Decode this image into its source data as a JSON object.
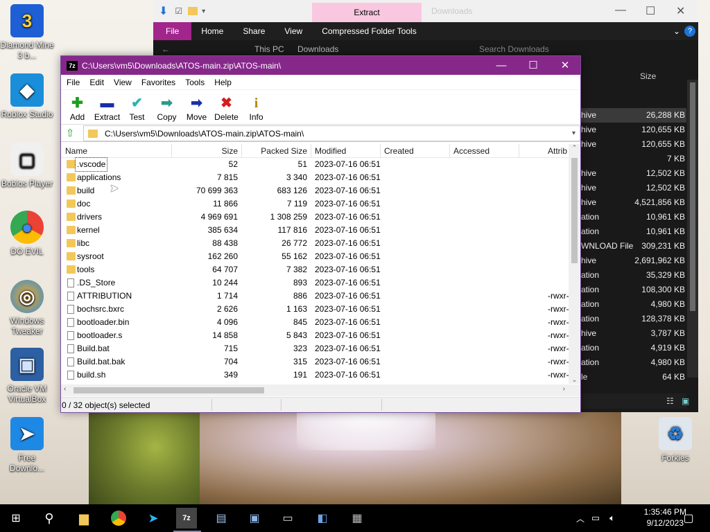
{
  "desktop": {
    "icons": [
      {
        "label": "Diamond Mine 3 b...",
        "glyph": "3"
      },
      {
        "label": "Roblox Studio",
        "glyph": "◆"
      },
      {
        "label": "Boblos Player",
        "glyph": "▢"
      },
      {
        "label": "DO EVIL",
        "glyph": "●"
      },
      {
        "label": "Windows Tweaker",
        "glyph": "◎"
      },
      {
        "label": "Oracle VM VirtualBox",
        "glyph": "▣"
      },
      {
        "label": "Free Downlo...",
        "glyph": "➤"
      },
      {
        "label": "Forkies",
        "glyph": "♻"
      }
    ]
  },
  "explorer": {
    "context_tab": "Extract",
    "faded_title": "Downloads",
    "ribbon": [
      "File",
      "Home",
      "Share",
      "View",
      "Compressed Folder Tools"
    ],
    "breadcrumb": [
      "This PC",
      "Downloads"
    ],
    "search_placeholder": "Search Downloads",
    "size_header": "Size",
    "rows": [
      {
        "type": "hive",
        "size": "26,288 KB",
        "selected": true
      },
      {
        "type": "hive",
        "size": "120,655 KB"
      },
      {
        "type": "hive",
        "size": "120,655 KB"
      },
      {
        "type": "",
        "size": "7 KB"
      },
      {
        "type": "hive",
        "size": "12,502 KB"
      },
      {
        "type": "hive",
        "size": "12,502 KB"
      },
      {
        "type": "hive",
        "size": "4,521,856 KB"
      },
      {
        "type": "ation",
        "size": "10,961 KB"
      },
      {
        "type": "ation",
        "size": "10,961 KB"
      },
      {
        "type": "WNLOAD File",
        "size": "309,231 KB"
      },
      {
        "type": "hive",
        "size": "2,691,962 KB"
      },
      {
        "type": "ation",
        "size": "35,329 KB"
      },
      {
        "type": "ation",
        "size": "108,300 KB"
      },
      {
        "type": "ation",
        "size": "4,980 KB"
      },
      {
        "type": "ation",
        "size": "128,378 KB"
      },
      {
        "type": "hive",
        "size": "3,787 KB"
      },
      {
        "type": "ation",
        "size": "4,919 KB"
      },
      {
        "type": "ation",
        "size": "4,980 KB"
      },
      {
        "type": "le",
        "size": "64 KB"
      }
    ]
  },
  "sevenzip": {
    "title": "C:\\Users\\vm5\\Downloads\\ATOS-main.zip\\ATOS-main\\",
    "app_icon": "7z",
    "menu": [
      "File",
      "Edit",
      "View",
      "Favorites",
      "Tools",
      "Help"
    ],
    "toolbar": [
      {
        "label": "Add",
        "glyph": "✚",
        "color": "#1e9e1e"
      },
      {
        "label": "Extract",
        "glyph": "▬",
        "color": "#1a2fa8"
      },
      {
        "label": "Test",
        "glyph": "✔",
        "color": "#2bb3b3"
      },
      {
        "label": "Copy",
        "glyph": "➡",
        "color": "#2a9a8a"
      },
      {
        "label": "Move",
        "glyph": "➡",
        "color": "#1a2fa8"
      },
      {
        "label": "Delete",
        "glyph": "✖",
        "color": "#d21f1f"
      },
      {
        "label": "Info",
        "glyph": "i",
        "color": "#b38a00"
      }
    ],
    "address": "C:\\Users\\vm5\\Downloads\\ATOS-main.zip\\ATOS-main\\",
    "columns": [
      "Name",
      "Size",
      "Packed Size",
      "Modified",
      "Created",
      "Accessed",
      "Attrib"
    ],
    "rows": [
      {
        "name": ".vscode",
        "kind": "folder",
        "size": "52",
        "packed": "51",
        "modified": "2023-07-16 06:51",
        "attrib": ""
      },
      {
        "name": "applications",
        "kind": "folder",
        "size": "7 815",
        "packed": "3 340",
        "modified": "2023-07-16 06:51",
        "attrib": ""
      },
      {
        "name": "build",
        "kind": "folder",
        "size": "70 699 363",
        "packed": "683 126",
        "modified": "2023-07-16 06:51",
        "attrib": ""
      },
      {
        "name": "doc",
        "kind": "folder",
        "size": "11 866",
        "packed": "7 119",
        "modified": "2023-07-16 06:51",
        "attrib": ""
      },
      {
        "name": "drivers",
        "kind": "folder",
        "size": "4 969 691",
        "packed": "1 308 259",
        "modified": "2023-07-16 06:51",
        "attrib": ""
      },
      {
        "name": "kernel",
        "kind": "folder",
        "size": "385 634",
        "packed": "117 816",
        "modified": "2023-07-16 06:51",
        "attrib": ""
      },
      {
        "name": "libc",
        "kind": "folder",
        "size": "88 438",
        "packed": "26 772",
        "modified": "2023-07-16 06:51",
        "attrib": ""
      },
      {
        "name": "sysroot",
        "kind": "folder",
        "size": "162 260",
        "packed": "55 162",
        "modified": "2023-07-16 06:51",
        "attrib": ""
      },
      {
        "name": "tools",
        "kind": "folder",
        "size": "64 707",
        "packed": "7 382",
        "modified": "2023-07-16 06:51",
        "attrib": ""
      },
      {
        "name": ".DS_Store",
        "kind": "file",
        "size": "10 244",
        "packed": "893",
        "modified": "2023-07-16 06:51",
        "attrib": ""
      },
      {
        "name": "ATTRIBUTION",
        "kind": "file",
        "size": "1 714",
        "packed": "886",
        "modified": "2023-07-16 06:51",
        "attrib": "-rwxr-"
      },
      {
        "name": "bochsrc.bxrc",
        "kind": "file",
        "size": "2 626",
        "packed": "1 163",
        "modified": "2023-07-16 06:51",
        "attrib": "-rwxr-"
      },
      {
        "name": "bootloader.bin",
        "kind": "file",
        "size": "4 096",
        "packed": "845",
        "modified": "2023-07-16 06:51",
        "attrib": "-rwxr-"
      },
      {
        "name": "bootloader.s",
        "kind": "file",
        "size": "14 858",
        "packed": "5 843",
        "modified": "2023-07-16 06:51",
        "attrib": "-rwxr-"
      },
      {
        "name": "Build.bat",
        "kind": "file",
        "size": "715",
        "packed": "323",
        "modified": "2023-07-16 06:51",
        "attrib": "-rwxr-"
      },
      {
        "name": "Build.bat.bak",
        "kind": "file",
        "size": "704",
        "packed": "315",
        "modified": "2023-07-16 06:51",
        "attrib": "-rwxr-"
      },
      {
        "name": "build.sh",
        "kind": "file",
        "size": "349",
        "packed": "191",
        "modified": "2023-07-16 06:51",
        "attrib": "-rwxr-"
      }
    ],
    "status": "0 / 32 object(s) selected"
  },
  "taskbar": {
    "time": "1:35:46 PM",
    "date": "9/12/2023"
  }
}
